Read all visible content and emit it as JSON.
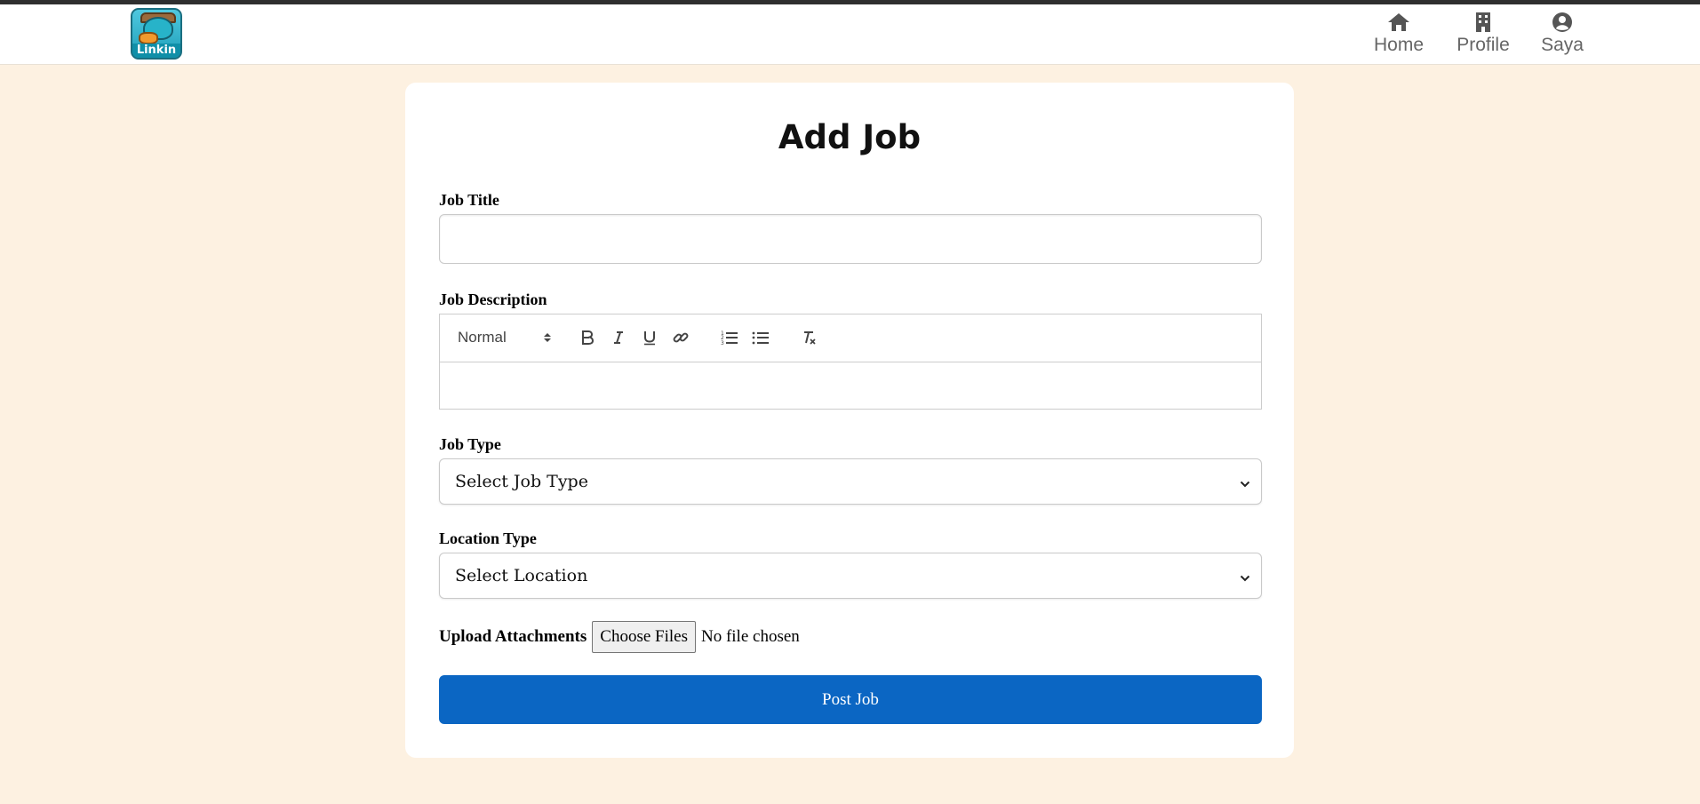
{
  "header": {
    "logo_text": "Linkin",
    "nav": [
      {
        "label": "Home",
        "icon": "home-icon"
      },
      {
        "label": "Profile",
        "icon": "building-icon"
      },
      {
        "label": "Saya",
        "icon": "user-circle-icon"
      }
    ]
  },
  "form": {
    "title": "Add Job",
    "job_title": {
      "label": "Job Title",
      "value": ""
    },
    "job_description": {
      "label": "Job Description",
      "format_value": "Normal",
      "toolbar_icons": [
        "bold-icon",
        "italic-icon",
        "underline-icon",
        "link-icon",
        "ordered-list-icon",
        "bullet-list-icon",
        "clear-format-icon"
      ],
      "value": ""
    },
    "job_type": {
      "label": "Job Type",
      "selected": "Select Job Type"
    },
    "location_type": {
      "label": "Location Type",
      "selected": "Select Location"
    },
    "attachments": {
      "label": "Upload Attachments",
      "button": "Choose Files",
      "status": "No file chosen"
    },
    "submit_label": "Post Job"
  },
  "colors": {
    "page_background": "#fdf1e1",
    "primary_button": "#0b66c3",
    "nav_text": "#666666"
  }
}
